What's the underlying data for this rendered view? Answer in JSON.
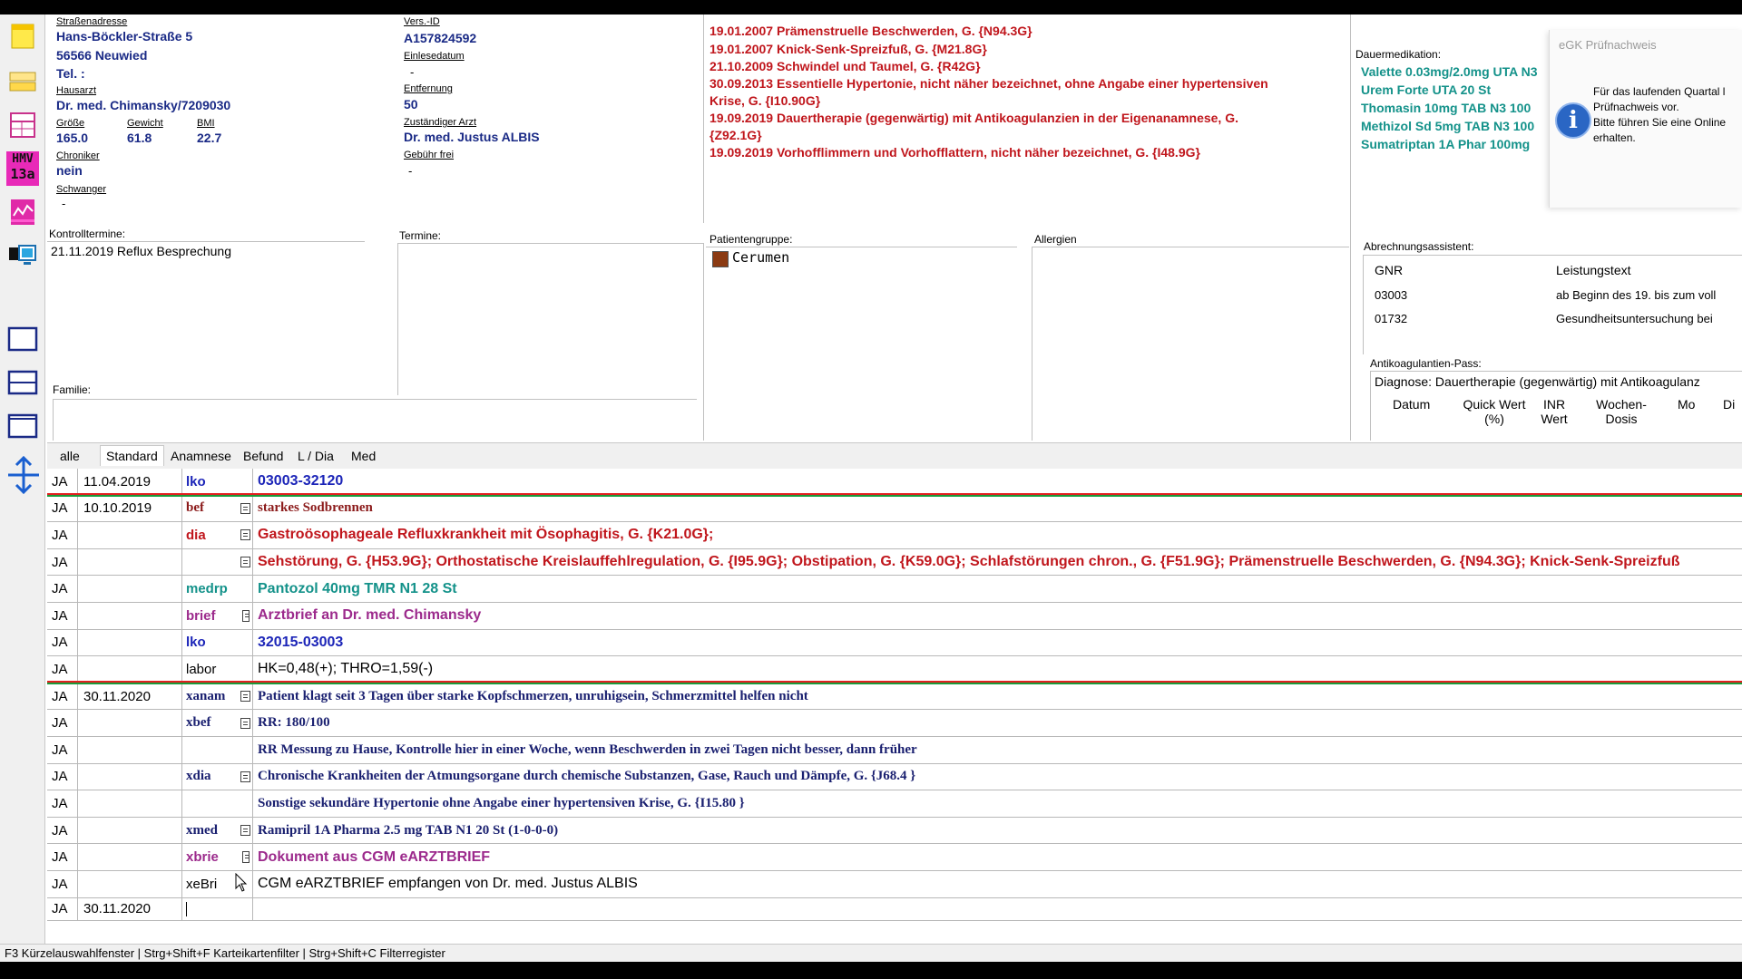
{
  "patient": {
    "address_label": "Straßenadresse",
    "street": "Hans-Böckler-Straße 5",
    "city": "56566 Neuwied",
    "tel": "Tel. :",
    "hausarzt_label": "Hausarzt",
    "hausarzt": "Dr. med. Chimansky/7209030",
    "groesse_label": "Größe",
    "groesse": "165.0",
    "gewicht_label": "Gewicht",
    "gewicht": "61.8",
    "bmi_label": "BMI",
    "bmi": "22.7",
    "chroniker_label": "Chroniker",
    "chroniker": "nein",
    "schwanger_label": "Schwanger",
    "schwanger": "-",
    "versid_label": "Vers.-ID",
    "versid": "A157824592",
    "einlese_label": "Einlesedatum",
    "einlese": "-",
    "entfernung_label": "Entfernung",
    "entfernung": "50",
    "arzt_label": "Zuständiger Arzt",
    "arzt": "Dr. med. Justus ALBIS",
    "gebuehr_label": "Gebühr frei",
    "gebuehr": "-"
  },
  "diagnoses": [
    "19.01.2007 Prämenstruelle Beschwerden, G. {N94.3G}",
    "19.01.2007 Knick-Senk-Spreizfuß, G. {M21.8G}",
    "21.10.2009 Schwindel und Taumel, G. {R42G}",
    "30.09.2013 Essentielle Hypertonie, nicht näher bezeichnet, ohne Angabe einer hypertensiven",
    "Krise, G. {I10.90G}",
    "19.09.2019 Dauertherapie (gegenwärtig) mit Antikoagulanzien in der Eigenanamnese, G.",
    "{Z92.1G}",
    "19.09.2019 Vorhofflimmern und Vorhofflattern, nicht näher bezeichnet, G. {I48.9G}"
  ],
  "dauermedikation": {
    "label": "Dauermedikation:",
    "items": [
      "Valette 0.03mg/2.0mg UTA N3",
      "Urem Forte UTA 20 St",
      "Thomasin 10mg TAB N3 100",
      "Methizol Sd 5mg TAB N3 100",
      "Sumatriptan 1A Phar 100mg"
    ]
  },
  "egk": {
    "title": "eGK Prüfnachweis",
    "line1": "Für das laufenden Quartal l",
    "line2": "Prüfnachweis vor.",
    "line3": "Bitte führen Sie eine Online",
    "line4": "erhalten.",
    "icon": "info-icon"
  },
  "sections": {
    "kontrolltermine_label": "Kontrolltermine:",
    "kontrolltermin": "21.11.2019 Reflux Besprechung",
    "termine_label": "Termine:",
    "patientengruppe_label": "Patientengruppe:",
    "patientengruppe": "Cerumen",
    "patientengruppe_color": "#8b3a12",
    "allergien_label": "Allergien",
    "familie_label": "Familie:"
  },
  "abrechnung": {
    "label": "Abrechnungsassistent:",
    "col_gnr": "GNR",
    "col_text": "Leistungstext",
    "rows": [
      {
        "gnr": "03003",
        "text": "ab Beginn des 19. bis zum voll"
      },
      {
        "gnr": "01732",
        "text": "Gesundheitsuntersuchung bei"
      }
    ]
  },
  "antikoag": {
    "label": "Antikoagulantien-Pass:",
    "diagnose": "Diagnose: Dauertherapie (gegenwärtig) mit Antikoagulanz",
    "col_datum": "Datum",
    "col_quick1": "Quick Wert",
    "col_quick2": "(%)",
    "col_inr1": "INR",
    "col_inr2": "Wert",
    "col_wochen1": "Wochen-",
    "col_wochen2": "Dosis",
    "col_mo": "Mo",
    "col_di": "Di"
  },
  "tabs": [
    "alle",
    "Standard",
    "Anamnese",
    "Befund",
    "L / Dia",
    "Med"
  ],
  "journal": [
    {
      "ja": "JA",
      "date": "11.04.2019",
      "type": "lko",
      "icon": "",
      "text": "03003-32120",
      "color": "#1c25b8",
      "tcolor": "#1c25b8",
      "font": "sans"
    },
    {
      "ja": "JA",
      "date": "10.10.2019",
      "type": "bef",
      "icon": "doc",
      "text": "starkes Sodbrennen",
      "color": "#8b1a1a",
      "tcolor": "#8b1a1a",
      "font": "serif"
    },
    {
      "ja": "JA",
      "date": "",
      "type": "dia",
      "icon": "list",
      "text": "Gastroösophageale Refluxkrankheit mit Ösophagitis, G. {K21.0G};",
      "color": "#c0161c",
      "tcolor": "#c0161c",
      "font": "sans"
    },
    {
      "ja": "JA",
      "date": "",
      "type": "",
      "icon": "list",
      "text": "Sehstörung, G. {H53.9G}; Orthostatische Kreislauffehlregulation, G. {I95.9G}; Obstipation, G. {K59.0G}; Schlafstörungen chron., G. {F51.9G}; Prämenstruelle Beschwerden, G. {N94.3G}; Knick-Senk-Spreizfuß",
      "color": "#c0161c",
      "tcolor": "#c0161c",
      "font": "sans"
    },
    {
      "ja": "JA",
      "date": "",
      "type": "medrp",
      "icon": "",
      "text": "Pantozol 40mg TMR N1 28 St",
      "color": "#14928a",
      "tcolor": "#14928a",
      "font": "sans"
    },
    {
      "ja": "JA",
      "date": "",
      "type": "brief",
      "icon": "page",
      "text": "Arztbrief an Dr. med. Chimansky",
      "color": "#9c2a8c",
      "tcolor": "#9c2a8c",
      "font": "sans"
    },
    {
      "ja": "JA",
      "date": "",
      "type": "lko",
      "icon": "",
      "text": "32015-03003",
      "color": "#1c25b8",
      "tcolor": "#1c25b8",
      "font": "sans"
    },
    {
      "ja": "JA",
      "date": "",
      "type": "labor",
      "icon": "",
      "text": "HK=0,48(+); THRO=1,59(-)",
      "color": "#000000",
      "tcolor": "#000000",
      "font": "sans",
      "normal": true
    },
    {
      "ja": "JA",
      "date": "30.11.2020",
      "type": "xanam",
      "icon": "doc",
      "text": "Patient klagt seit 3 Tagen über starke Kopfschmerzen, unruhigsein, Schmerzmittel helfen nicht",
      "color": "#1a2070",
      "tcolor": "#1a2070",
      "font": "serif"
    },
    {
      "ja": "JA",
      "date": "",
      "type": "xbef",
      "icon": "doc",
      "text": "RR: 180/100",
      "color": "#1a2070",
      "tcolor": "#1a2070",
      "font": "serif"
    },
    {
      "ja": "JA",
      "date": "",
      "type": "",
      "icon": "",
      "text": "RR Messung zu Hause, Kontrolle hier in einer Woche, wenn Beschwerden in zwei Tagen nicht besser, dann früher",
      "color": "#1a2070",
      "tcolor": "#1a2070",
      "font": "serif"
    },
    {
      "ja": "JA",
      "date": "",
      "type": "xdia",
      "icon": "doc",
      "text": "Chronische Krankheiten der Atmungsorgane durch chemische Substanzen, Gase, Rauch und Dämpfe, G. {J68.4 }",
      "color": "#1a2070",
      "tcolor": "#1a2070",
      "font": "serif"
    },
    {
      "ja": "JA",
      "date": "",
      "type": "",
      "icon": "",
      "text": "Sonstige sekundäre Hypertonie ohne Angabe einer hypertensiven Krise, G. {I15.80 }",
      "color": "#1a2070",
      "tcolor": "#1a2070",
      "font": "serif"
    },
    {
      "ja": "JA",
      "date": "",
      "type": "xmed",
      "icon": "doc",
      "text": "Ramipril 1A Pharma 2.5 mg TAB N1 20 St (1-0-0-0)",
      "color": "#1a2070",
      "tcolor": "#1a2070",
      "font": "serif"
    },
    {
      "ja": "JA",
      "date": "",
      "type": "xbrie",
      "icon": "page",
      "text": "Dokument aus CGM eARZTBRIEF",
      "color": "#9c2a8c",
      "tcolor": "#9c2a8c",
      "font": "sans"
    },
    {
      "ja": "JA",
      "date": "",
      "type": "xeBri",
      "icon": "",
      "text": "CGM eARZTBRIEF empfangen von Dr. med. Justus ALBIS",
      "color": "#000000",
      "tcolor": "#000000",
      "font": "sans",
      "normal": true
    }
  ],
  "input_row": {
    "ja": "JA",
    "date": "30.11.2020"
  },
  "status_bar": "F3 Kürzelauswahlfenster | Strg+Shift+F Karteikartenfilter | Strg+Shift+C Filterregister",
  "toolbar_icons": [
    "note-icon",
    "cards-icon",
    "calendar-grid-icon",
    "hmv-13a-icon",
    "chart-icon",
    "monitor-icon",
    "single-window-icon",
    "split-window-icon",
    "window-icon",
    "move-vertical-icon"
  ],
  "toolbar_text": {
    "hmv_top": "HMV",
    "hmv_bottom": "13a"
  }
}
